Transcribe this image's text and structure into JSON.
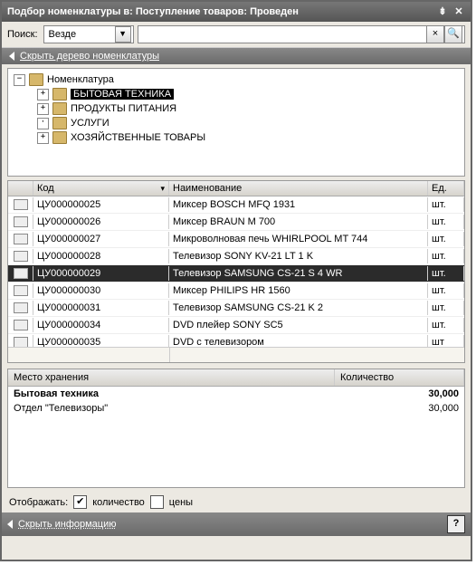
{
  "window": {
    "title": "Подбор номенклатуры в: Поступление товаров: Проведен"
  },
  "search": {
    "label": "Поиск:",
    "scope": "Везде",
    "value": ""
  },
  "tree": {
    "hide_label": "Скрыть дерево номенклатуры",
    "root": "Номенклатура",
    "items": [
      {
        "label": "БЫТОВАЯ ТЕХНИКА",
        "selected": true,
        "expander": "+"
      },
      {
        "label": "ПРОДУКТЫ ПИТАНИЯ",
        "selected": false,
        "expander": "+"
      },
      {
        "label": "УСЛУГИ",
        "selected": false,
        "expander": "·"
      },
      {
        "label": "ХОЗЯЙСТВЕННЫЕ ТОВАРЫ",
        "selected": false,
        "expander": "+"
      }
    ]
  },
  "grid": {
    "headers": {
      "code": "Код",
      "name": "Наименование",
      "unit": "Ед."
    },
    "rows": [
      {
        "code": "ЦУ000000025",
        "name": "Миксер BOSCH MFQ 1931",
        "unit": "шт.",
        "selected": false
      },
      {
        "code": "ЦУ000000026",
        "name": "Миксер BRAUN M 700",
        "unit": "шт.",
        "selected": false
      },
      {
        "code": "ЦУ000000027",
        "name": "Микроволновая печь WHIRLPOOL MT 744",
        "unit": "шт.",
        "selected": false
      },
      {
        "code": "ЦУ000000028",
        "name": "Телевизор SONY KV-21 LT 1 K",
        "unit": "шт.",
        "selected": false
      },
      {
        "code": "ЦУ000000029",
        "name": "Телевизор SAMSUNG CS-21 S 4 WR",
        "unit": "шт.",
        "selected": true
      },
      {
        "code": "ЦУ000000030",
        "name": "Миксер PHILIPS HR 1560",
        "unit": "шт.",
        "selected": false
      },
      {
        "code": "ЦУ000000031",
        "name": "Телевизор SAMSUNG CS-21 K 2",
        "unit": "шт.",
        "selected": false
      },
      {
        "code": "ЦУ000000034",
        "name": "DVD плейер SONY SC5",
        "unit": "шт.",
        "selected": false
      },
      {
        "code": "ЦУ000000035",
        "name": "DVD с телевизором",
        "unit": "шт",
        "selected": false
      }
    ]
  },
  "storage": {
    "headers": {
      "place": "Место хранения",
      "qty": "Количество"
    },
    "rows": [
      {
        "place": "Бытовая техника",
        "qty": "30,000",
        "bold": true
      },
      {
        "place": "Отдел \"Телевизоры\"",
        "qty": "30,000",
        "bold": false
      }
    ]
  },
  "display": {
    "label": "Отображать:",
    "opt_qty": "количество",
    "opt_prices": "цены",
    "qty_checked": true,
    "prices_checked": false
  },
  "footer": {
    "hide_info": "Скрыть информацию"
  }
}
